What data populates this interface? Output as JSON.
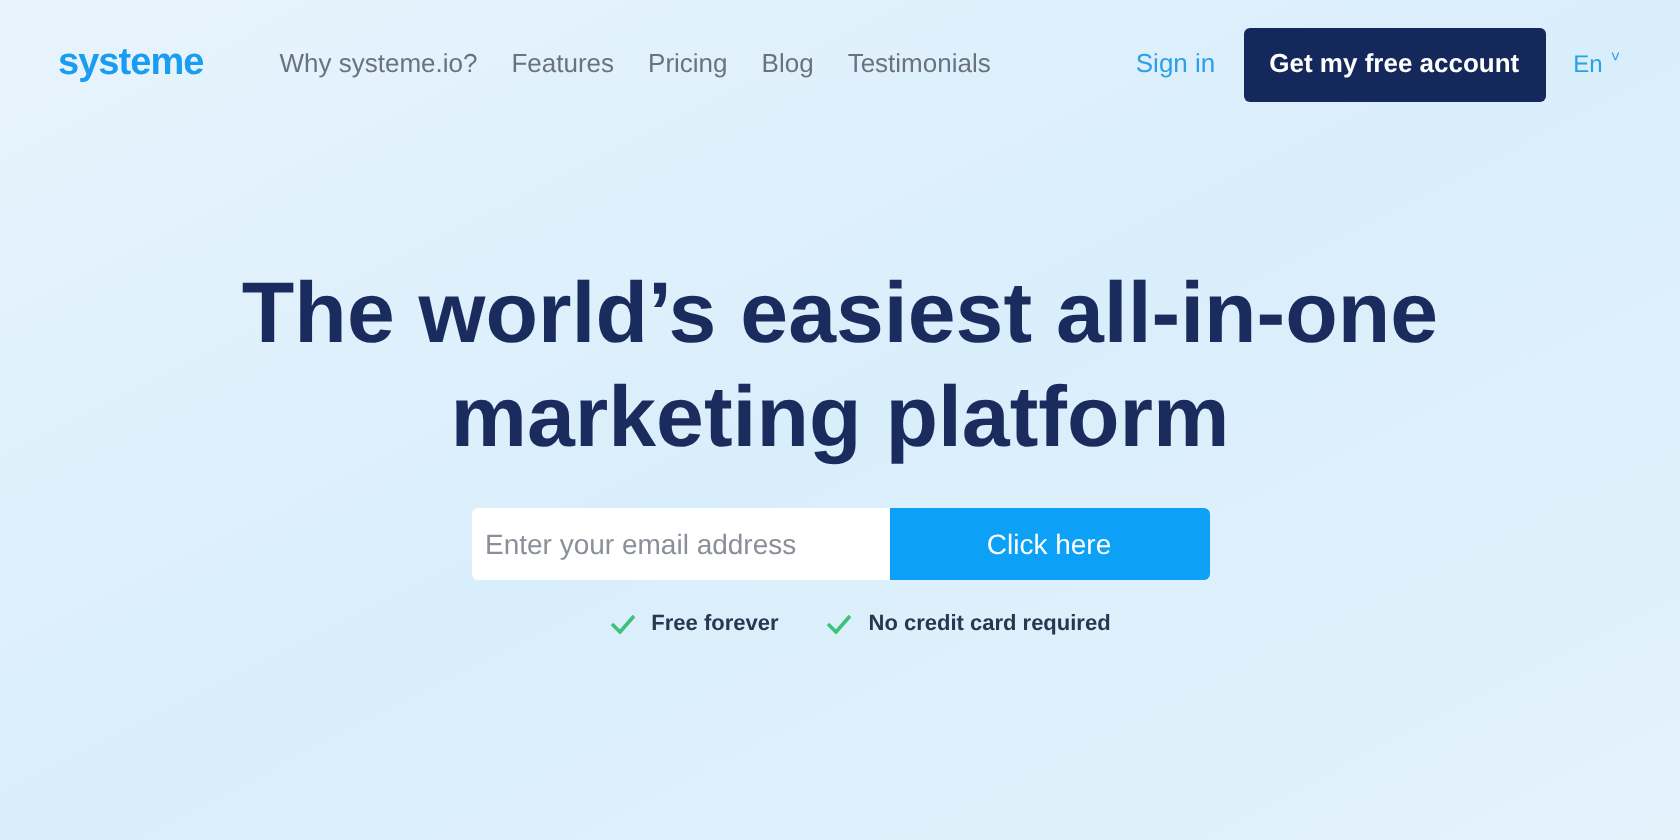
{
  "header": {
    "logo": "systeme",
    "nav": [
      "Why systeme.io?",
      "Features",
      "Pricing",
      "Blog",
      "Testimonials"
    ],
    "sign_in": "Sign in",
    "cta": "Get my free account",
    "language": "En",
    "language_caret": "˅"
  },
  "hero": {
    "title_lines": [
      "The world’s easiest all-in-one",
      "marketing platform"
    ],
    "email_field": {
      "placeholder": "Enter your email address"
    },
    "submit": "Click here",
    "perks": [
      "Free forever",
      "No credit card required"
    ]
  }
}
